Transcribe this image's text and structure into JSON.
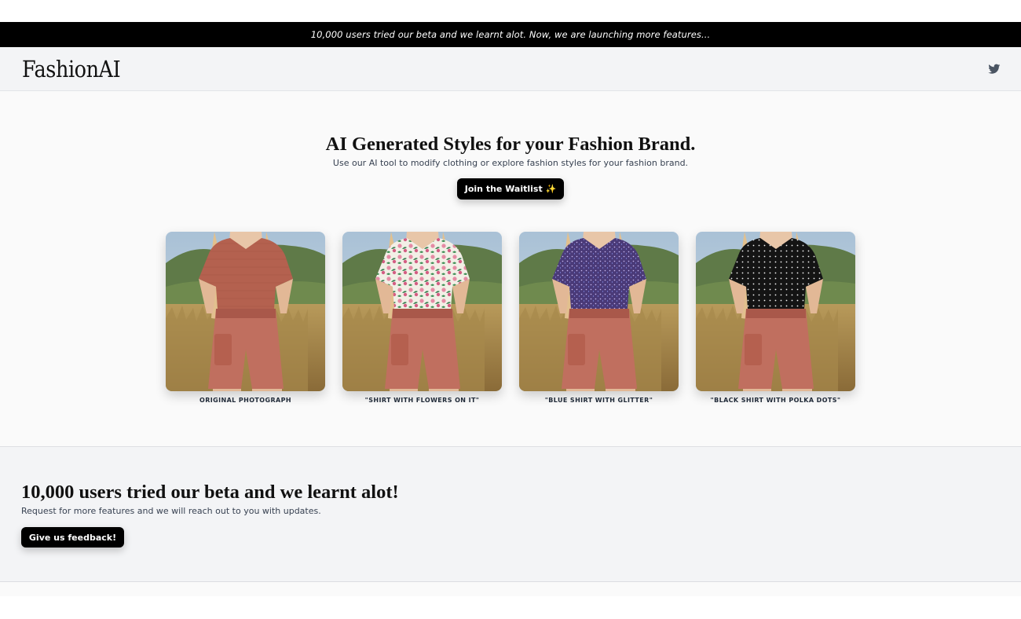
{
  "announcement": {
    "text": "10,000 users tried our beta and we learnt alot. Now, we are launching more features..."
  },
  "nav": {
    "logo": "FashionAI",
    "social_icon": "twitter-icon"
  },
  "hero": {
    "title": "AI Generated Styles for your Fashion Brand.",
    "subtitle": "Use our AI tool to modify clothing or explore fashion styles for your fashion brand.",
    "cta_label": "Join the Waitlist ✨"
  },
  "gallery": [
    {
      "caption": "ORIGINAL PHOTOGRAPH",
      "shirt_color": "#b4614f",
      "shirt_pattern": "plain"
    },
    {
      "caption": "\"SHIRT WITH FLOWERS ON IT\"",
      "shirt_color": "#f2efe6",
      "shirt_pattern": "flowers"
    },
    {
      "caption": "\"BLUE SHIRT WITH GLITTER\"",
      "shirt_color": "#4a3a78",
      "shirt_pattern": "glitter"
    },
    {
      "caption": "\"BLACK SHIRT WITH POLKA DOTS\"",
      "shirt_color": "#141414",
      "shirt_pattern": "polka"
    }
  ],
  "beta": {
    "title": "10,000 users tried our beta and we learnt alot!",
    "subtitle": "Request for more features and we will reach out to you with updates.",
    "cta_label": "Give us feedback!"
  },
  "colors": {
    "announcement_bg": "#000000",
    "button_bg": "#000000",
    "nav_bg": "#f3f4f6",
    "shorts": "#c06f5f",
    "hair": "#e2c08e"
  }
}
